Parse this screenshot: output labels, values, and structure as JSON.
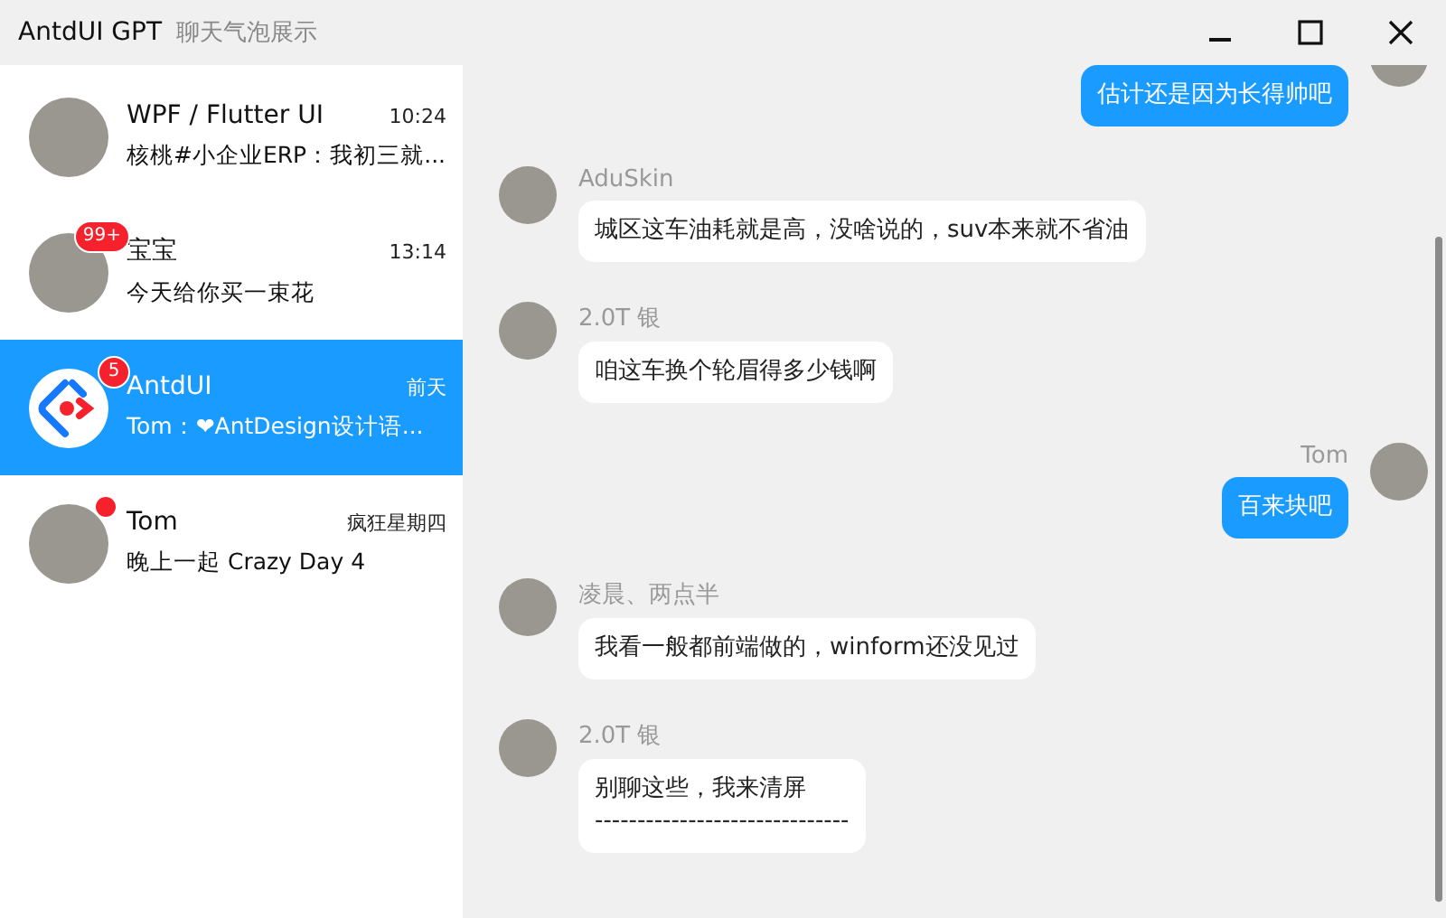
{
  "window": {
    "title": "AntdUI GPT",
    "subtitle": "聊天气泡展示"
  },
  "conversations": [
    {
      "name": "WPF / Flutter UI",
      "time": "10:24",
      "preview": "核桃#小企业ERP：我初三就...",
      "kind": "photo",
      "dot": false,
      "selected": false
    },
    {
      "name": "宝宝",
      "time": "13:14",
      "preview": "今天给你买一束花",
      "kind": "photo",
      "badge": "99+",
      "dot": false,
      "selected": false
    },
    {
      "name": "AntdUI",
      "time": "前天",
      "preview": "Tom：❤AntDesign设计语...",
      "kind": "logo",
      "badge": "5",
      "dot": false,
      "selected": true
    },
    {
      "name": "Tom",
      "time": "疯狂星期四",
      "preview": "晚上一起 Crazy Day 4",
      "kind": "photo",
      "dot": true,
      "selected": false
    }
  ],
  "messages": [
    {
      "kind": "outgoing",
      "text": "估计还是因为长得帅吧"
    },
    {
      "kind": "incoming",
      "sender": "AduSkin",
      "text": "城区这车油耗就是高，没啥说的，suv本来就不省油"
    },
    {
      "kind": "incoming",
      "sender": "2.0T 银",
      "text": "咱这车换个轮眉得多少钱啊"
    },
    {
      "kind": "outgoing",
      "sender": "Tom",
      "text": "百来块吧"
    },
    {
      "kind": "incoming",
      "sender": "凌晨、两点半",
      "text": "我看一般都前端做的，winform还没见过"
    },
    {
      "kind": "incoming",
      "sender": "2.0T 银",
      "text": "别聊这些，我来清屏\n------------------------------"
    }
  ]
}
